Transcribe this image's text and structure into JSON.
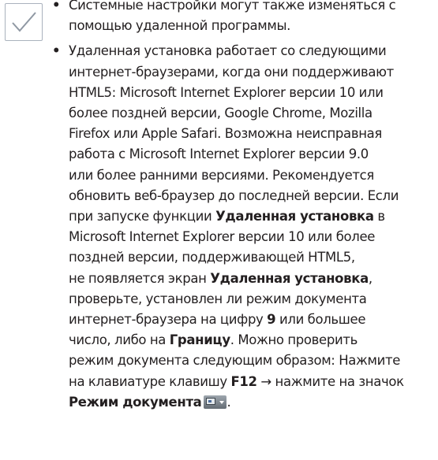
{
  "icon": "checkmark-note-icon",
  "bullet_symbol": "•",
  "bullet1": {
    "lines": [
      "Системные настройки могут также изменяться с",
      "помощью удаленной программы."
    ]
  },
  "bullet2": {
    "l1": "Удаленная установка работает со следующими",
    "l2": "интернет-браузерами, когда они поддерживают",
    "l3": "HTML5: Microsoft Internet Explorer версии 10 или",
    "l4": "более поздней версии, Google Chrome, Mozilla",
    "l5": "Firefox или Apple Safari. Возможна неисправная",
    "l6": "работа с Microsoft Internet Explorer версии 9.0",
    "l7": "или более ранними версиями. Рекомендуется",
    "l8": "обновить веб-браузер до последней версии. Если",
    "l9a": "при запуске функции ",
    "l9b": "Удаленная установка",
    "l9c": " в",
    "l10": "Microsoft Internet Explorer версии 10 или более",
    "l11": "поздней версии, поддерживающей HTML5,",
    "l12a": "не появляется экран ",
    "l12b": "Удаленная установка",
    "l12c": ",",
    "l13": "проверьте, установлен ли режим документа",
    "l14a": "интернет-браузера на цифру ",
    "l14b": "9",
    "l14c": " или большее",
    "l15a": "число, либо на ",
    "l15b": "Границу",
    "l15c": ". Можно проверить",
    "l16": "режим документа следующим образом: Нажмите",
    "l17a": "на клавиатуре клавишу ",
    "l17b": "F12",
    "l17c": " → нажмите на значок",
    "l18a": "Режим документа",
    "l18b": ".",
    "doc_mode_icon": "document-mode-icon"
  }
}
